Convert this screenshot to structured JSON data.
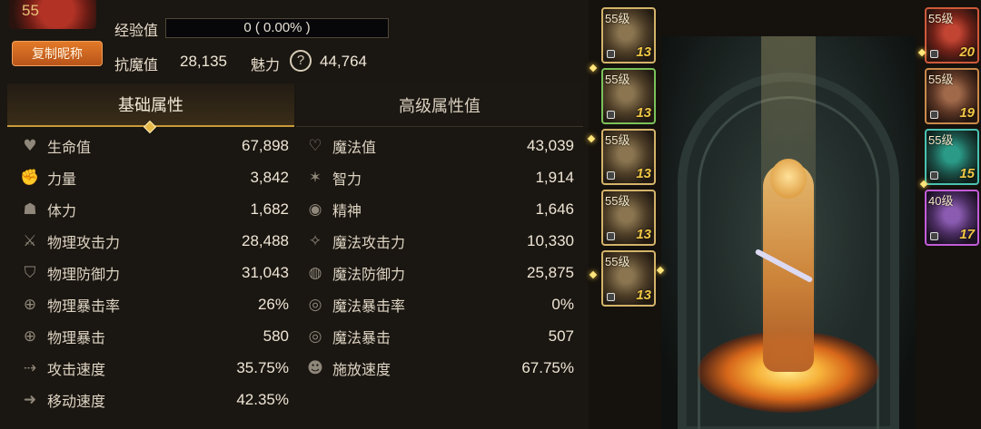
{
  "header": {
    "level": "55",
    "copy_name_label": "复制昵称",
    "exp_label": "经验值",
    "exp_text": "0 ( 0.00% )",
    "exp_progress": 0,
    "anti_magic_label": "抗魔值",
    "anti_magic_value": "28,135",
    "charm_label": "魅力",
    "charm_help": "?",
    "charm_value": "44,764"
  },
  "tabs": {
    "basic": "基础属性",
    "advanced": "高级属性值"
  },
  "stats_left": [
    {
      "icon": "heart-icon",
      "name": "生命值",
      "value": "67,898"
    },
    {
      "icon": "fist-icon",
      "name": "力量",
      "value": "3,842"
    },
    {
      "icon": "body-icon",
      "name": "体力",
      "value": "1,682"
    },
    {
      "icon": "sword-icon",
      "name": "物理攻击力",
      "value": "28,488"
    },
    {
      "icon": "shield-icon",
      "name": "物理防御力",
      "value": "31,043"
    },
    {
      "icon": "crosshair-icon",
      "name": "物理暴击率",
      "value": "26%"
    },
    {
      "icon": "crosshair-icon",
      "name": "物理暴击",
      "value": "580"
    },
    {
      "icon": "boot-icon",
      "name": "攻击速度",
      "value": "35.75%"
    },
    {
      "icon": "run-icon",
      "name": "移动速度",
      "value": "42.35%"
    }
  ],
  "stats_right": [
    {
      "icon": "heart-outline-icon",
      "name": "魔法值",
      "value": "43,039"
    },
    {
      "icon": "brain-icon",
      "name": "智力",
      "value": "1,914"
    },
    {
      "icon": "orb-icon",
      "name": "精神",
      "value": "1,646"
    },
    {
      "icon": "magic-burst-icon",
      "name": "魔法攻击力",
      "value": "10,330"
    },
    {
      "icon": "magic-shield-icon",
      "name": "魔法防御力",
      "value": "25,875"
    },
    {
      "icon": "target-icon",
      "name": "魔法暴击率",
      "value": "0%"
    },
    {
      "icon": "target-icon",
      "name": "魔法暴击",
      "value": "507"
    },
    {
      "icon": "head-icon",
      "name": "施放速度",
      "value": "67.75%"
    }
  ],
  "equip_left": [
    {
      "level": "55级",
      "enhance": "13",
      "icon": "gauntlet-icon",
      "rarity": "gold"
    },
    {
      "level": "55级",
      "enhance": "13",
      "icon": "armor-icon",
      "rarity": "green"
    },
    {
      "level": "55级",
      "enhance": "13",
      "icon": "pants-icon",
      "rarity": "gold"
    },
    {
      "level": "55级",
      "enhance": "13",
      "icon": "belt-icon",
      "rarity": "gold"
    },
    {
      "level": "55级",
      "enhance": "13",
      "icon": "boots-icon",
      "rarity": "gold"
    }
  ],
  "equip_right": [
    {
      "level": "55级",
      "enhance": "20",
      "icon": "weapon-icon",
      "rarity": "red"
    },
    {
      "level": "55级",
      "enhance": "19",
      "icon": "ring-icon",
      "rarity": "bronze"
    },
    {
      "level": "55级",
      "enhance": "15",
      "icon": "necklace-icon",
      "rarity": "teal"
    },
    {
      "level": "40级",
      "enhance": "17",
      "icon": "bracelet-icon",
      "rarity": "purple"
    }
  ]
}
